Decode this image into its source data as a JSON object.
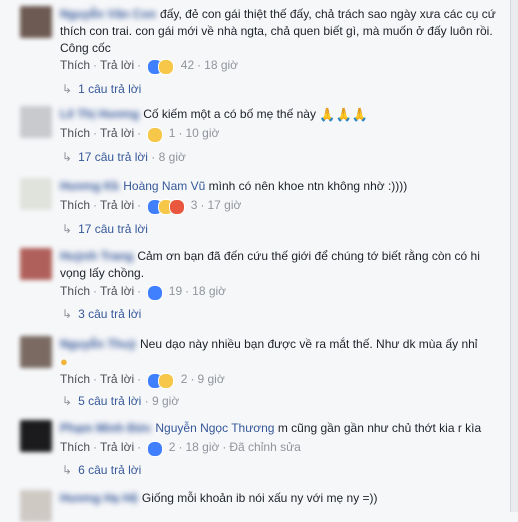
{
  "comments": [
    {
      "name": "Nguyễn Văn Con",
      "text": "đấy, đẻ con gái thiệt thế đấy, chả trách sao ngày xưa các cụ cứ thích con trai. con gái mới về nhà ngta, chả quen biết gì, mà muốn ở đấy luôn rồi. Công cốc",
      "like": "Thích",
      "reply": "Trả lời",
      "count": "42",
      "time": "18 giờ",
      "replies": "1 câu trả lời"
    },
    {
      "name": "Lê Thị Hương",
      "text": "Cố kiếm một a có bố mẹ thế này",
      "like": "Thích",
      "reply": "Trả lời",
      "count": "1",
      "time": "10 giờ",
      "replies": "17 câu trả lời",
      "replies_time": "8 giờ"
    },
    {
      "name": "Hương Kk",
      "tag": "Hoàng Nam Vũ",
      "text": "mình có nên khoe ntn không nhờ :))))",
      "like": "Thích",
      "reply": "Trả lời",
      "count": "3",
      "time": "17 giờ",
      "replies": "17 câu trả lời"
    },
    {
      "name": "Huỳnh Trang",
      "text": "Cảm ơn bạn đã đến cứu thế giới để chúng tớ biết rằng còn có hi vọng lấy chồng.",
      "like": "Thích",
      "reply": "Trả lời",
      "count": "19",
      "time": "18 giờ",
      "replies": "3 câu trả lời"
    },
    {
      "name": "Nguyễn Thuỳ",
      "text": "Neu dạo này nhiều bạn được về ra mắt thế. Như dk mùa ấy nhỉ",
      "like": "Thích",
      "reply": "Trả lời",
      "count": "2",
      "time": "9 giờ",
      "replies": "5 câu trả lời",
      "replies_time": "9 giờ"
    },
    {
      "name": "Phạm Minh Đức",
      "tag": "Nguyễn Ngọc Thương",
      "text": "m cũng gần gần như chủ thớt kia r kìa",
      "like": "Thích",
      "reply": "Trả lời",
      "count": "2",
      "time": "18 giờ",
      "edited": "Đã chỉnh sửa",
      "replies": "6 câu trả lời"
    },
    {
      "name": "Hương Hạ Hệ",
      "text": "Giống mỗi khoản ib nói xấu ny với mẹ ny =))"
    }
  ],
  "colors": {
    "link": "#365899",
    "meta": "#90949c",
    "like": "#4080ff"
  }
}
